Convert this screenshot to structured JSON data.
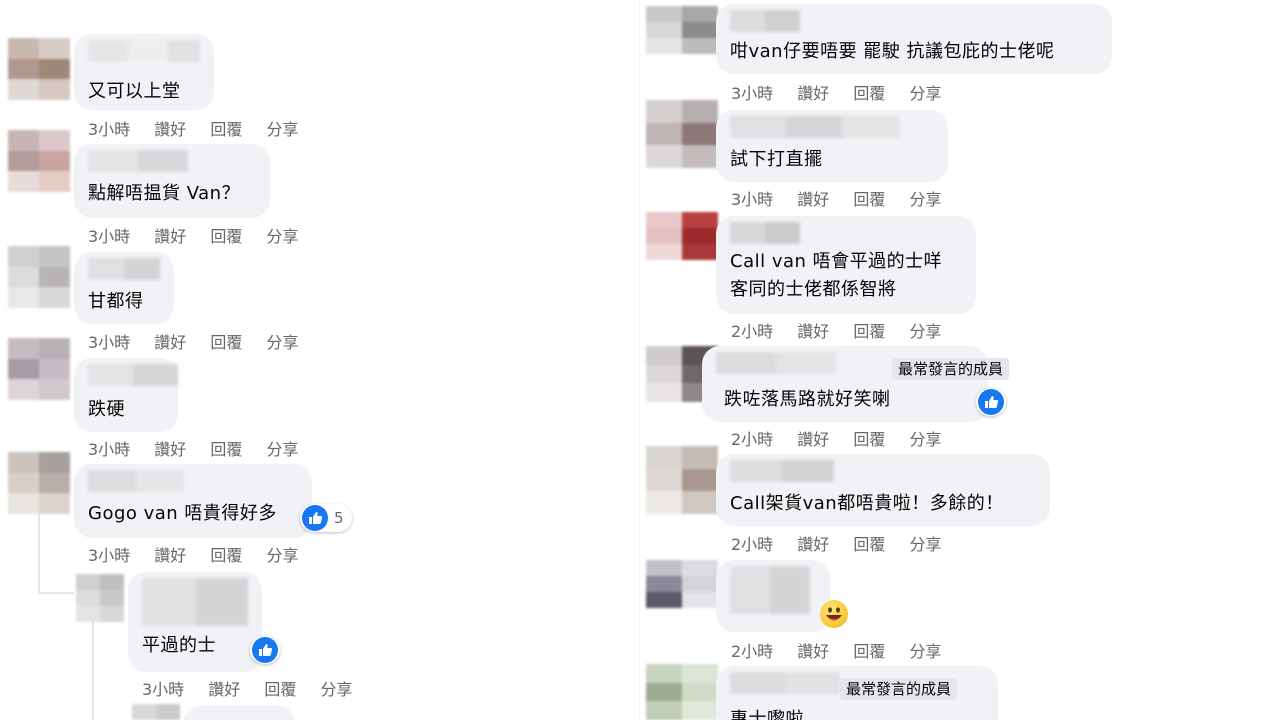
{
  "colors": {
    "bubble": "#f0f2f5",
    "meta_text": "#65676b",
    "like_blue": "#1877f2",
    "badge_bg": "#e4e6eb"
  },
  "labels": {
    "like": "讚好",
    "reply": "回覆",
    "share": "分享"
  },
  "left_comments": [
    {
      "text": "又可以上堂",
      "time": "3小時"
    },
    {
      "text": "點解唔揾貨 Van？",
      "time": "3小時"
    },
    {
      "text": "甘都得",
      "time": "3小時"
    },
    {
      "text": "跌硬",
      "time": "3小時"
    },
    {
      "text": "Gogo van 唔貴得好多",
      "time": "3小時",
      "likes": "5"
    },
    {
      "text": "平過的士",
      "time": "3小時"
    }
  ],
  "right_comments": [
    {
      "text": "咁van仔要唔要 罷駛 抗議包庇的士佬呢",
      "time": "3小時"
    },
    {
      "text": "試下打直擺",
      "time": "3小時"
    },
    {
      "text_line1": "Call van 唔會平過的士咩",
      "text_line2": "客同的士佬都係智將",
      "time": "2小時"
    },
    {
      "badge": "最常發言的成員",
      "text": "跌咗落馬路就好笑喇",
      "time": "2小時"
    },
    {
      "text": "Call架貨van都唔貴啦！多餘的！",
      "time": "2小時"
    },
    {
      "time": "2小時",
      "emoji": "grinning-face-emoji"
    },
    {
      "badge": "最常發言的成員",
      "text": "專士嚟啦"
    }
  ]
}
